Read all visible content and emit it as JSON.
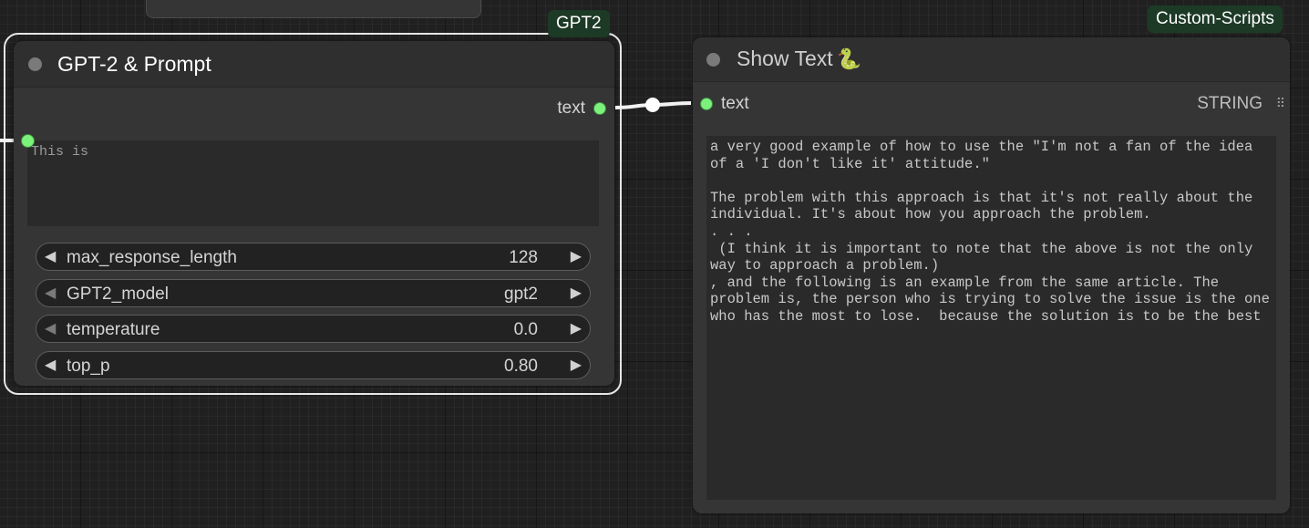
{
  "badges": {
    "group": "GPT2",
    "package": "Custom-Scripts"
  },
  "gpt_node": {
    "title": "GPT-2 & Prompt",
    "output_label": "text",
    "prompt_value": "This is",
    "widgets": [
      {
        "name": "max_response_length",
        "value": "128",
        "left_arrow_dim": false
      },
      {
        "name": "GPT2_model",
        "value": "gpt2",
        "left_arrow_dim": true
      },
      {
        "name": "temperature",
        "value": "0.0",
        "left_arrow_dim": true
      },
      {
        "name": "top_p",
        "value": "0.80",
        "left_arrow_dim": false
      }
    ]
  },
  "show_node": {
    "title": "Show Text",
    "title_icon": "snake-icon",
    "input_label": "text",
    "input_type": "STRING",
    "output_text": "a very good example of how to use the \"I'm not a fan of the idea of a 'I don't like it' attitude.\"\n\nThe problem with this approach is that it's not really about the individual. It's about how you approach the problem.\n. . .\n (I think it is important to note that the above is not the only way to approach a problem.)\n, and the following is an example from the same article. The problem is, the person who is trying to solve the issue is the one who has the most to lose.  because the solution is to be the best"
  },
  "colors": {
    "canvas": "#202020",
    "node": "#353535",
    "slot": "#7cf27c",
    "badge": "#1d3a26",
    "link": "#f2f2f2"
  }
}
